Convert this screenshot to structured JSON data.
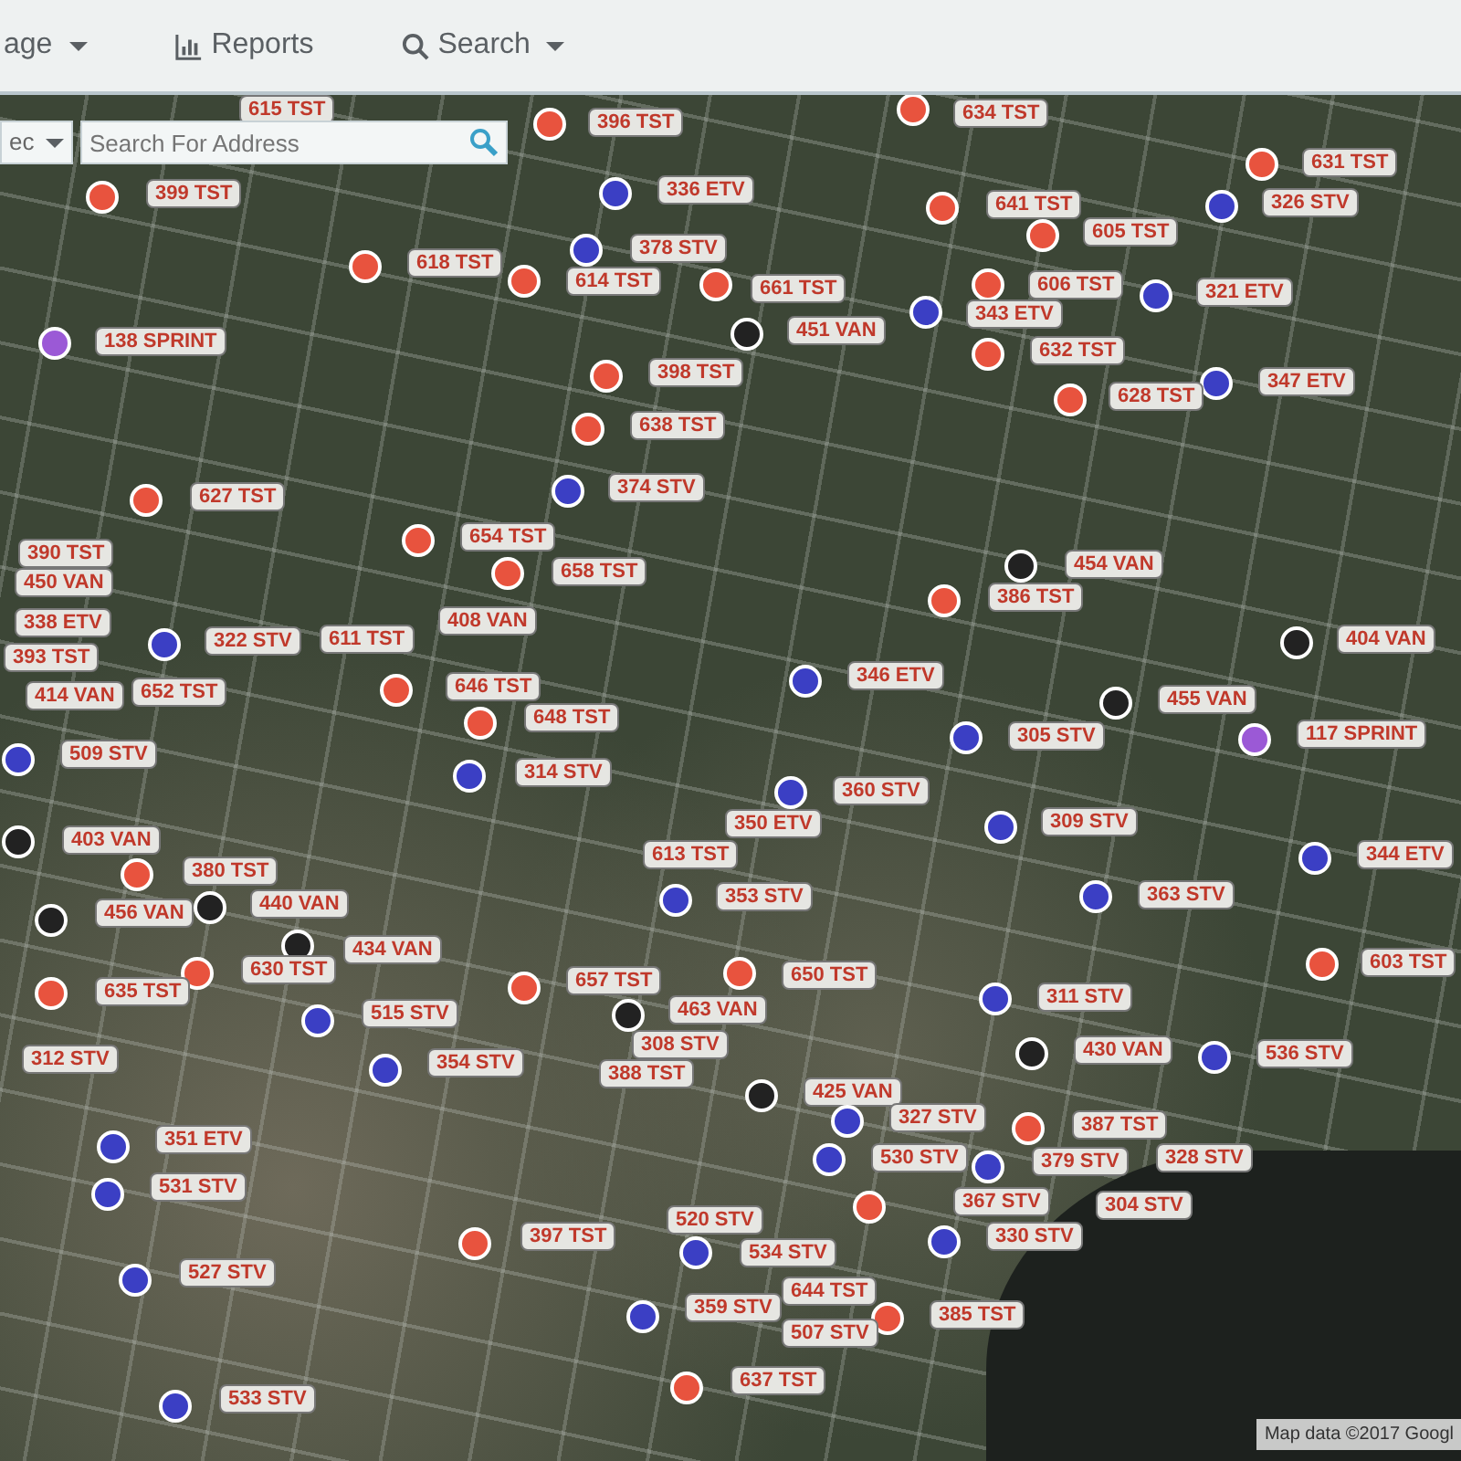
{
  "nav": {
    "items": [
      {
        "label": "age",
        "caret": true
      },
      {
        "label": "Reports",
        "caret": false
      },
      {
        "label": "Search",
        "caret": true
      }
    ]
  },
  "map": {
    "layer_select": {
      "value": "ec"
    },
    "search": {
      "placeholder": "Search For Address"
    },
    "markers": [
      {
        "label": "615 TST"
      },
      {
        "label": "396 TST",
        "color": "#e8533e"
      },
      {
        "label": "634 TST",
        "color": "#e8533e"
      },
      {
        "label": "631 TST",
        "color": "#e8533e"
      },
      {
        "label": "399 TST",
        "color": "#e8533e"
      },
      {
        "label": "336 ETV",
        "color": "#3b3fc4"
      },
      {
        "label": "641 TST",
        "color": "#e8533e"
      },
      {
        "label": "326 STV",
        "color": "#3b3fc4"
      },
      {
        "label": "605 TST",
        "color": "#e8533e"
      },
      {
        "label": "618 TST",
        "color": "#e8533e"
      },
      {
        "label": "378 STV",
        "color": "#3b3fc4"
      },
      {
        "label": "614 TST",
        "color": "#e8533e"
      },
      {
        "label": "661 TST",
        "color": "#e8533e"
      },
      {
        "label": "606 TST",
        "color": "#e8533e"
      },
      {
        "label": "321 ETV",
        "color": "#3b3fc4"
      },
      {
        "label": "343 ETV",
        "color": "#3b3fc4"
      },
      {
        "label": "138 SPRINT",
        "color": "#9b59d6"
      },
      {
        "label": "451 VAN",
        "color": "#222222"
      },
      {
        "label": "632 TST",
        "color": "#e8533e"
      },
      {
        "label": "398 TST",
        "color": "#e8533e"
      },
      {
        "label": "347 ETV",
        "color": "#3b3fc4"
      },
      {
        "label": "628 TST",
        "color": "#e8533e"
      },
      {
        "label": "638 TST",
        "color": "#e8533e"
      },
      {
        "label": "374 STV",
        "color": "#3b3fc4"
      },
      {
        "label": "627 TST",
        "color": "#e8533e"
      },
      {
        "label": "654 TST",
        "color": "#e8533e"
      },
      {
        "label": "390 TST"
      },
      {
        "label": "454 VAN",
        "color": "#222222"
      },
      {
        "label": "450 VAN"
      },
      {
        "label": "658 TST",
        "color": "#e8533e"
      },
      {
        "label": "386 TST",
        "color": "#e8533e"
      },
      {
        "label": "338 ETV"
      },
      {
        "label": "408 VAN"
      },
      {
        "label": "322 STV",
        "color": "#3b3fc4"
      },
      {
        "label": "611 TST"
      },
      {
        "label": "404 VAN",
        "color": "#222222"
      },
      {
        "label": "393 TST"
      },
      {
        "label": "646 TST",
        "color": "#e8533e"
      },
      {
        "label": "346 ETV",
        "color": "#3b3fc4"
      },
      {
        "label": "414 VAN"
      },
      {
        "label": "652 TST"
      },
      {
        "label": "455 VAN",
        "color": "#222222"
      },
      {
        "label": "648 TST",
        "color": "#e8533e"
      },
      {
        "label": "305 STV",
        "color": "#3b3fc4"
      },
      {
        "label": "117 SPRINT",
        "color": "#9b59d6"
      },
      {
        "label": "509 STV",
        "color": "#3b3fc4"
      },
      {
        "label": "314 STV",
        "color": "#3b3fc4"
      },
      {
        "label": "360 STV",
        "color": "#3b3fc4"
      },
      {
        "label": "350 ETV"
      },
      {
        "label": "309 STV",
        "color": "#3b3fc4"
      },
      {
        "label": "403 VAN",
        "color": "#222222"
      },
      {
        "label": "613 TST"
      },
      {
        "label": "344 ETV",
        "color": "#3b3fc4"
      },
      {
        "label": "380 TST",
        "color": "#e8533e"
      },
      {
        "label": "440 VAN",
        "color": "#222222"
      },
      {
        "label": "353 STV",
        "color": "#3b3fc4"
      },
      {
        "label": "363 STV",
        "color": "#3b3fc4"
      },
      {
        "label": "456 VAN",
        "color": "#222222"
      },
      {
        "label": "434 VAN",
        "color": "#222222"
      },
      {
        "label": "603 TST",
        "color": "#e8533e"
      },
      {
        "label": "630 TST",
        "color": "#e8533e"
      },
      {
        "label": "657 TST",
        "color": "#e8533e"
      },
      {
        "label": "650 TST",
        "color": "#e8533e"
      },
      {
        "label": "635 TST",
        "color": "#e8533e"
      },
      {
        "label": "311 STV",
        "color": "#3b3fc4"
      },
      {
        "label": "515 STV",
        "color": "#3b3fc4"
      },
      {
        "label": "463 VAN",
        "color": "#222222"
      },
      {
        "label": "312 STV"
      },
      {
        "label": "308 STV"
      },
      {
        "label": "430 VAN",
        "color": "#222222"
      },
      {
        "label": "536 STV",
        "color": "#3b3fc4"
      },
      {
        "label": "354 STV",
        "color": "#3b3fc4"
      },
      {
        "label": "388 TST"
      },
      {
        "label": "425 VAN",
        "color": "#222222"
      },
      {
        "label": "327 STV",
        "color": "#3b3fc4"
      },
      {
        "label": "387 TST",
        "color": "#e8533e"
      },
      {
        "label": "351 ETV",
        "color": "#3b3fc4"
      },
      {
        "label": "530 STV",
        "color": "#3b3fc4"
      },
      {
        "label": "379 STV",
        "color": "#3b3fc4"
      },
      {
        "label": "328 STV"
      },
      {
        "label": "531 STV",
        "color": "#3b3fc4"
      },
      {
        "label": "367 STV",
        "color": "#e8533e"
      },
      {
        "label": "520 STV"
      },
      {
        "label": "304 STV"
      },
      {
        "label": "397 TST",
        "color": "#e8533e"
      },
      {
        "label": "330 STV",
        "color": "#3b3fc4"
      },
      {
        "label": "534 STV",
        "color": "#3b3fc4"
      },
      {
        "label": "527 STV",
        "color": "#3b3fc4"
      },
      {
        "label": "644 TST"
      },
      {
        "label": "359 STV",
        "color": "#3b3fc4"
      },
      {
        "label": "385 TST",
        "color": "#e8533e"
      },
      {
        "label": "507 STV"
      },
      {
        "label": "637 TST",
        "color": "#e8533e"
      },
      {
        "label": "533 STV",
        "color": "#3b3fc4"
      }
    ],
    "attribution": "Map data ©2017 Googl"
  }
}
